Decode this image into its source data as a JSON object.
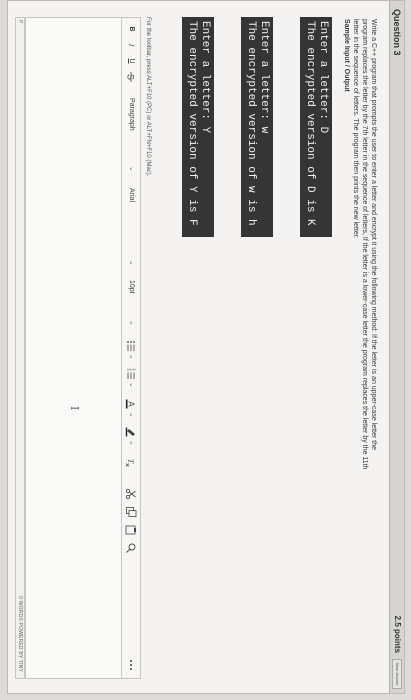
{
  "question": {
    "title": "Question 3",
    "points": "2.5 points",
    "save_label": "Save Answer"
  },
  "prompt": {
    "line1": "Write a C++ program that prompts the user to enter a letter and encrypt it using the following method: If the letter is an upper-case letter the",
    "line2": "program replaces the letter by the 7th letter in the sequence of letters, If the letter is a lower-case letter the program replaces the letter by the 11th",
    "line3": "letter in the sequence of letters. The program then prints the new letter.",
    "sample_heading": "Sample Input / Output"
  },
  "samples": [
    {
      "prompt_line": "Enter a letter: D",
      "output_line": "The encrypted version of D is K"
    },
    {
      "prompt_line": "Enter a letter: w",
      "output_line": "The encrypted version of w is h"
    },
    {
      "prompt_line": "Enter a letter: Y",
      "output_line": "The encrypted version of Y is F"
    }
  ],
  "editor": {
    "hint": "For the toolbar, press ALT+F10 (PC) or ALT+FN+F10 (Mac).",
    "toolbar": {
      "bold": "B",
      "italic": "I",
      "underline": "U",
      "paragraph": "Paragraph",
      "font": "Arial",
      "size": "10pt"
    },
    "path_label": "P",
    "word_count": "0 WORDS  POWERED BY TINY"
  },
  "colors": {
    "console_bg": "#353535",
    "console_text": "#f0f0f0",
    "card_bg": "#f4f3f1"
  }
}
